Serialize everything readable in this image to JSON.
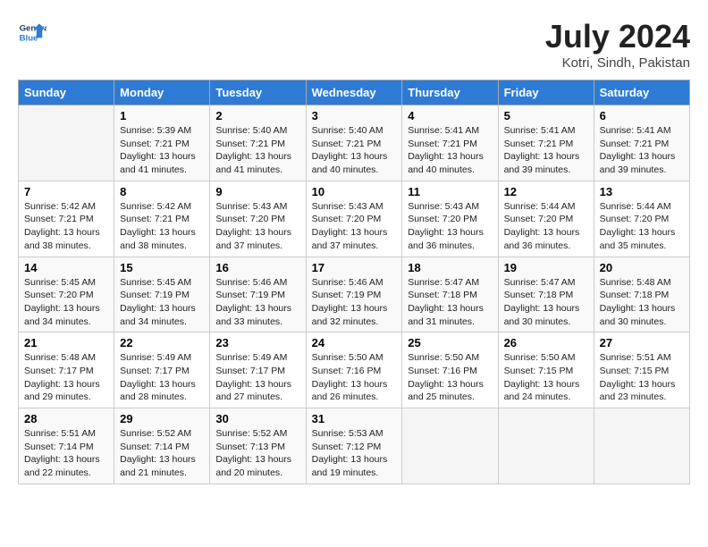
{
  "header": {
    "logo_line1": "General",
    "logo_line2": "Blue",
    "month_year": "July 2024",
    "location": "Kotri, Sindh, Pakistan"
  },
  "weekdays": [
    "Sunday",
    "Monday",
    "Tuesday",
    "Wednesday",
    "Thursday",
    "Friday",
    "Saturday"
  ],
  "weeks": [
    [
      {
        "day": "",
        "sunrise": "",
        "sunset": "",
        "daylight": ""
      },
      {
        "day": "1",
        "sunrise": "Sunrise: 5:39 AM",
        "sunset": "Sunset: 7:21 PM",
        "daylight": "Daylight: 13 hours and 41 minutes."
      },
      {
        "day": "2",
        "sunrise": "Sunrise: 5:40 AM",
        "sunset": "Sunset: 7:21 PM",
        "daylight": "Daylight: 13 hours and 41 minutes."
      },
      {
        "day": "3",
        "sunrise": "Sunrise: 5:40 AM",
        "sunset": "Sunset: 7:21 PM",
        "daylight": "Daylight: 13 hours and 40 minutes."
      },
      {
        "day": "4",
        "sunrise": "Sunrise: 5:41 AM",
        "sunset": "Sunset: 7:21 PM",
        "daylight": "Daylight: 13 hours and 40 minutes."
      },
      {
        "day": "5",
        "sunrise": "Sunrise: 5:41 AM",
        "sunset": "Sunset: 7:21 PM",
        "daylight": "Daylight: 13 hours and 39 minutes."
      },
      {
        "day": "6",
        "sunrise": "Sunrise: 5:41 AM",
        "sunset": "Sunset: 7:21 PM",
        "daylight": "Daylight: 13 hours and 39 minutes."
      }
    ],
    [
      {
        "day": "7",
        "sunrise": "Sunrise: 5:42 AM",
        "sunset": "Sunset: 7:21 PM",
        "daylight": "Daylight: 13 hours and 38 minutes."
      },
      {
        "day": "8",
        "sunrise": "Sunrise: 5:42 AM",
        "sunset": "Sunset: 7:21 PM",
        "daylight": "Daylight: 13 hours and 38 minutes."
      },
      {
        "day": "9",
        "sunrise": "Sunrise: 5:43 AM",
        "sunset": "Sunset: 7:20 PM",
        "daylight": "Daylight: 13 hours and 37 minutes."
      },
      {
        "day": "10",
        "sunrise": "Sunrise: 5:43 AM",
        "sunset": "Sunset: 7:20 PM",
        "daylight": "Daylight: 13 hours and 37 minutes."
      },
      {
        "day": "11",
        "sunrise": "Sunrise: 5:43 AM",
        "sunset": "Sunset: 7:20 PM",
        "daylight": "Daylight: 13 hours and 36 minutes."
      },
      {
        "day": "12",
        "sunrise": "Sunrise: 5:44 AM",
        "sunset": "Sunset: 7:20 PM",
        "daylight": "Daylight: 13 hours and 36 minutes."
      },
      {
        "day": "13",
        "sunrise": "Sunrise: 5:44 AM",
        "sunset": "Sunset: 7:20 PM",
        "daylight": "Daylight: 13 hours and 35 minutes."
      }
    ],
    [
      {
        "day": "14",
        "sunrise": "Sunrise: 5:45 AM",
        "sunset": "Sunset: 7:20 PM",
        "daylight": "Daylight: 13 hours and 34 minutes."
      },
      {
        "day": "15",
        "sunrise": "Sunrise: 5:45 AM",
        "sunset": "Sunset: 7:19 PM",
        "daylight": "Daylight: 13 hours and 34 minutes."
      },
      {
        "day": "16",
        "sunrise": "Sunrise: 5:46 AM",
        "sunset": "Sunset: 7:19 PM",
        "daylight": "Daylight: 13 hours and 33 minutes."
      },
      {
        "day": "17",
        "sunrise": "Sunrise: 5:46 AM",
        "sunset": "Sunset: 7:19 PM",
        "daylight": "Daylight: 13 hours and 32 minutes."
      },
      {
        "day": "18",
        "sunrise": "Sunrise: 5:47 AM",
        "sunset": "Sunset: 7:18 PM",
        "daylight": "Daylight: 13 hours and 31 minutes."
      },
      {
        "day": "19",
        "sunrise": "Sunrise: 5:47 AM",
        "sunset": "Sunset: 7:18 PM",
        "daylight": "Daylight: 13 hours and 30 minutes."
      },
      {
        "day": "20",
        "sunrise": "Sunrise: 5:48 AM",
        "sunset": "Sunset: 7:18 PM",
        "daylight": "Daylight: 13 hours and 30 minutes."
      }
    ],
    [
      {
        "day": "21",
        "sunrise": "Sunrise: 5:48 AM",
        "sunset": "Sunset: 7:17 PM",
        "daylight": "Daylight: 13 hours and 29 minutes."
      },
      {
        "day": "22",
        "sunrise": "Sunrise: 5:49 AM",
        "sunset": "Sunset: 7:17 PM",
        "daylight": "Daylight: 13 hours and 28 minutes."
      },
      {
        "day": "23",
        "sunrise": "Sunrise: 5:49 AM",
        "sunset": "Sunset: 7:17 PM",
        "daylight": "Daylight: 13 hours and 27 minutes."
      },
      {
        "day": "24",
        "sunrise": "Sunrise: 5:50 AM",
        "sunset": "Sunset: 7:16 PM",
        "daylight": "Daylight: 13 hours and 26 minutes."
      },
      {
        "day": "25",
        "sunrise": "Sunrise: 5:50 AM",
        "sunset": "Sunset: 7:16 PM",
        "daylight": "Daylight: 13 hours and 25 minutes."
      },
      {
        "day": "26",
        "sunrise": "Sunrise: 5:50 AM",
        "sunset": "Sunset: 7:15 PM",
        "daylight": "Daylight: 13 hours and 24 minutes."
      },
      {
        "day": "27",
        "sunrise": "Sunrise: 5:51 AM",
        "sunset": "Sunset: 7:15 PM",
        "daylight": "Daylight: 13 hours and 23 minutes."
      }
    ],
    [
      {
        "day": "28",
        "sunrise": "Sunrise: 5:51 AM",
        "sunset": "Sunset: 7:14 PM",
        "daylight": "Daylight: 13 hours and 22 minutes."
      },
      {
        "day": "29",
        "sunrise": "Sunrise: 5:52 AM",
        "sunset": "Sunset: 7:14 PM",
        "daylight": "Daylight: 13 hours and 21 minutes."
      },
      {
        "day": "30",
        "sunrise": "Sunrise: 5:52 AM",
        "sunset": "Sunset: 7:13 PM",
        "daylight": "Daylight: 13 hours and 20 minutes."
      },
      {
        "day": "31",
        "sunrise": "Sunrise: 5:53 AM",
        "sunset": "Sunset: 7:12 PM",
        "daylight": "Daylight: 13 hours and 19 minutes."
      },
      {
        "day": "",
        "sunrise": "",
        "sunset": "",
        "daylight": ""
      },
      {
        "day": "",
        "sunrise": "",
        "sunset": "",
        "daylight": ""
      },
      {
        "day": "",
        "sunrise": "",
        "sunset": "",
        "daylight": ""
      }
    ]
  ]
}
